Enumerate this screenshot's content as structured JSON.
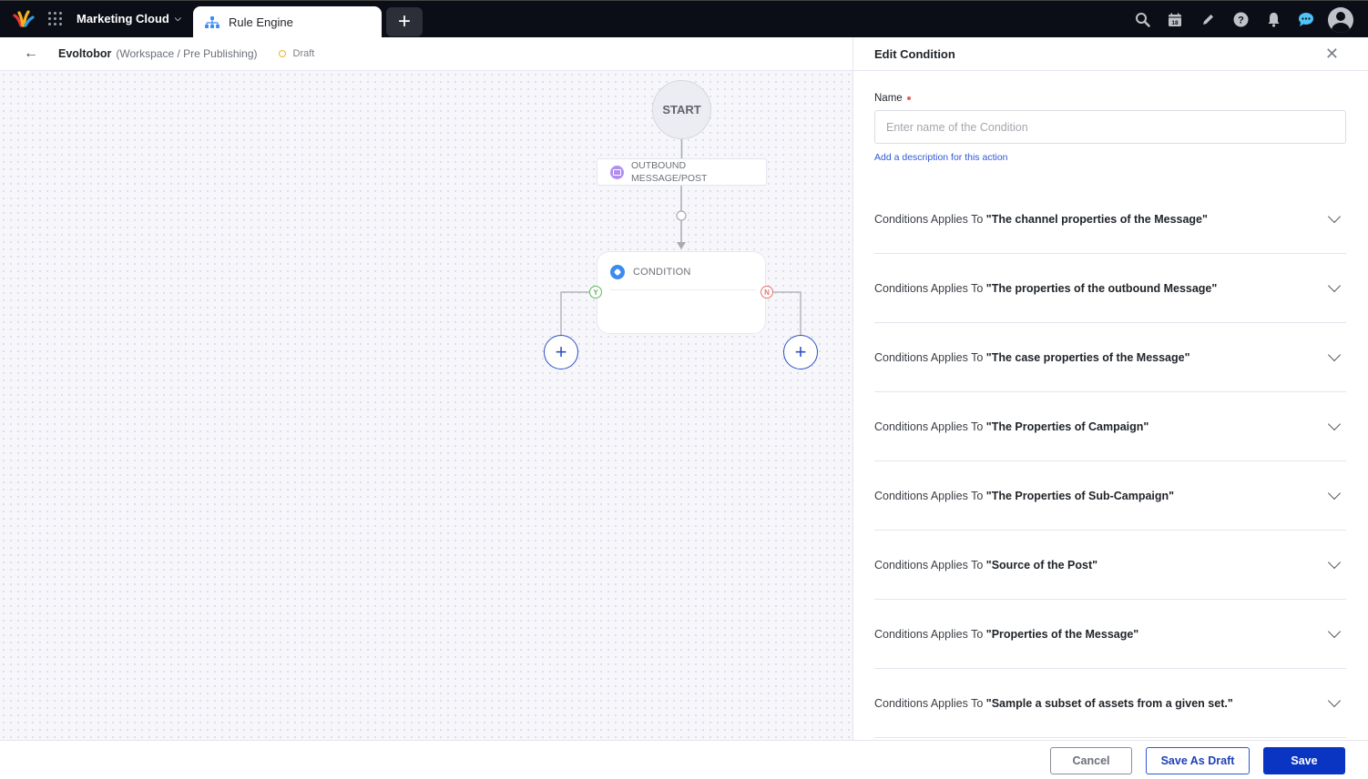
{
  "topbar": {
    "product_label": "Marketing Cloud",
    "active_tab_label": "Rule Engine",
    "icons": [
      "search-icon",
      "calendar-icon",
      "pencil-icon",
      "help-icon",
      "bell-icon",
      "chat-icon",
      "user-avatar"
    ],
    "calendar_day": "18"
  },
  "subheader": {
    "workspace_name": "Evoltobor",
    "workspace_path": "(Workspace / Pre Publishing)",
    "status": "Draft",
    "status_color": "#f0b429"
  },
  "canvas": {
    "start_label": "START",
    "outbound_label_line1": "OUTBOUND",
    "outbound_label_line2": "MESSAGE/POST",
    "condition_label": "CONDITION",
    "yes_label": "Y",
    "no_label": "N",
    "add_symbol": "+"
  },
  "panel": {
    "title": "Edit Condition",
    "name_label": "Name",
    "name_placeholder": "Enter name of the Condition",
    "name_value": "",
    "description_link": "Add a description for this action",
    "condition_prefix": "Conditions Applies To",
    "conditions": [
      {
        "target": "\"The channel properties of the Message\""
      },
      {
        "target": "\"The properties of the outbound Message\""
      },
      {
        "target": "\"The case properties of the Message\""
      },
      {
        "target": "\"The Properties of Campaign\""
      },
      {
        "target": "\"The Properties of Sub-Campaign\""
      },
      {
        "target": "\"Source of the Post\""
      },
      {
        "target": "\"Properties of the Message\""
      },
      {
        "target": "\"Sample a subset of assets from a given set.\""
      }
    ]
  },
  "footer": {
    "cancel_label": "Cancel",
    "save_draft_label": "Save As Draft",
    "save_label": "Save"
  },
  "colors": {
    "primary": "#0a35c2",
    "link": "#2f58d6",
    "yes": "#5cb85c",
    "no": "#e57373"
  }
}
